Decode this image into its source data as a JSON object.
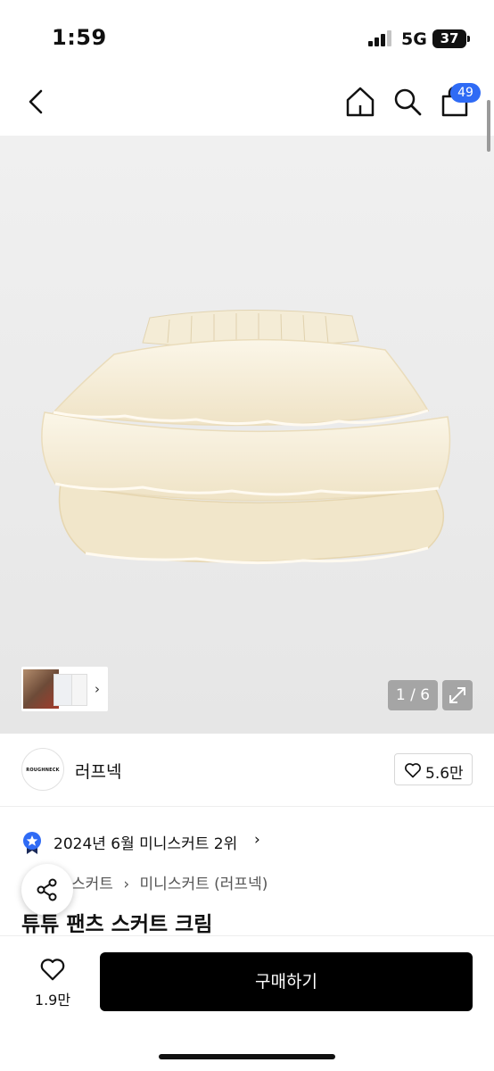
{
  "status_bar": {
    "time": "1:59",
    "network": "5G",
    "battery": "37"
  },
  "nav": {
    "back_icon": "chevron-left-icon",
    "home_icon": "home-icon",
    "search_icon": "search-icon",
    "cart_icon": "shopping-bag-icon",
    "cart_count": "49",
    "accent_color": "#2f6bf5"
  },
  "gallery": {
    "counter": "1 / 6",
    "thumb_chevron": "›"
  },
  "brand": {
    "logo_text": "ROUGHNECK",
    "name": "러프넥",
    "likes": "5.6만"
  },
  "ranking": {
    "text": "2024년 6월 미니스커트 2위",
    "chevron": "›"
  },
  "breadcrumb": [
    "스커트",
    "›",
    "미니스커트 (러프넥)"
  ],
  "product": {
    "title": "튜튜 팬츠 스커트 크림"
  },
  "bottom": {
    "wish_count": "1.9만",
    "buy_label": "구매하기"
  }
}
